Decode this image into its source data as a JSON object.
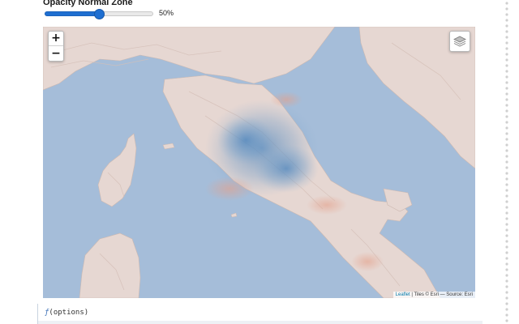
{
  "opacity_control": {
    "label": "Opacity Normal Zone",
    "value_text": "50%",
    "value_fraction": 0.5,
    "accent_color": "#1f6fd1"
  },
  "map": {
    "zoom_in_label": "+",
    "zoom_out_label": "−",
    "layers_icon": "layers-icon",
    "attribution": {
      "link": "Leaflet",
      "text": " | Tiles © Esri — Source: Esri"
    },
    "colors": {
      "sea": "#a5bdd9",
      "land": "#e6d7d2",
      "overlay_blue": "#5b8fc2",
      "overlay_red": "#e0a58f"
    }
  },
  "code": {
    "fn": "ƒ",
    "args": "(options)"
  }
}
